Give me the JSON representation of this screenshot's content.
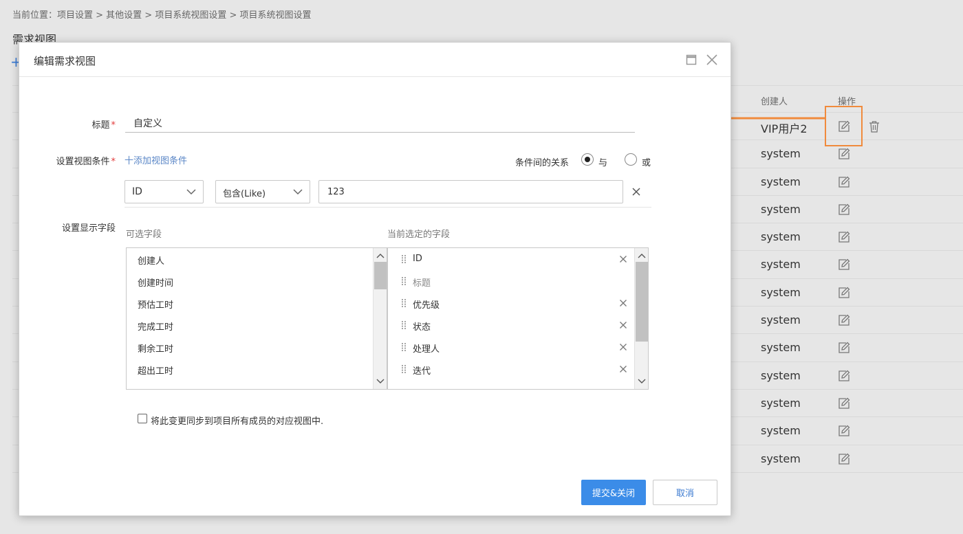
{
  "breadcrumb": "当前位置：项目设置 > 其他设置 > 项目系统视图设置 > 项目系统视图设置",
  "page_title": "需求视图",
  "add_icon": "+",
  "table": {
    "headers": {
      "creator": "创建人",
      "ops": "操作"
    },
    "rows": [
      {
        "creator": "VIP用户2",
        "deletable": true
      },
      {
        "creator": "system"
      },
      {
        "creator": "system"
      },
      {
        "creator": "system"
      },
      {
        "creator": "system"
      },
      {
        "creator": "system"
      },
      {
        "creator": "system"
      },
      {
        "creator": "system"
      },
      {
        "creator": "system"
      },
      {
        "creator": "system"
      },
      {
        "creator": "system"
      },
      {
        "creator": "system"
      },
      {
        "creator": "system"
      }
    ]
  },
  "modal": {
    "title": "编辑需求视图",
    "labels": {
      "title": "标题",
      "conditions": "设置视图条件",
      "fields": "设置显示字段",
      "required_mark": "*"
    },
    "title_value": "自定义",
    "add_condition": "十添加视图条件",
    "relation_label": "条件间的关系",
    "relation_and": "与",
    "relation_or": "或",
    "relation_selected": "and",
    "condition": {
      "field": "ID",
      "operator": "包含(Like)",
      "value": "123"
    },
    "available_header": "可选字段",
    "selected_header": "当前选定的字段",
    "available_fields": [
      "创建人",
      "创建时间",
      "预估工时",
      "完成工时",
      "剩余工时",
      "超出工时"
    ],
    "selected_fields": [
      {
        "label": "ID",
        "removable": true
      },
      {
        "label": "标题",
        "removable": false
      },
      {
        "label": "优先级",
        "removable": true
      },
      {
        "label": "状态",
        "removable": true
      },
      {
        "label": "处理人",
        "removable": true
      },
      {
        "label": "迭代",
        "removable": true
      }
    ],
    "sync_label": "将此变更同步到项目所有成员的对应视图中.",
    "sync_checked": false,
    "submit_label": "提交&关闭",
    "cancel_label": "取消"
  },
  "colors": {
    "primary": "#3b8ce8",
    "link": "#5b87c7",
    "annotation": "#f08a3c",
    "required": "#e23b3b"
  }
}
